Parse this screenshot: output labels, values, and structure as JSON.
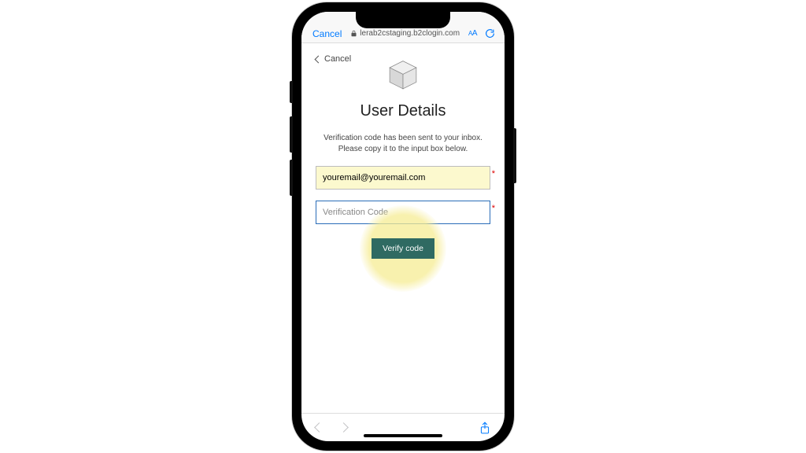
{
  "browser": {
    "cancel": "Cancel",
    "url": "lerab2cstaging.b2clogin.com",
    "aa_label": "AA"
  },
  "page": {
    "back_label": "Cancel",
    "title": "User Details",
    "instruction_line1": "Verification code has been sent to your inbox.",
    "instruction_line2": "Please copy it to the input box below."
  },
  "fields": {
    "email_value": "youremail@youremail.com",
    "code_placeholder": "Verification Code"
  },
  "buttons": {
    "verify": "Verify code"
  },
  "colors": {
    "accent_blue": "#007aff",
    "verify_btn": "#2f6a62",
    "highlight_yellow": "#fcf9ce"
  }
}
